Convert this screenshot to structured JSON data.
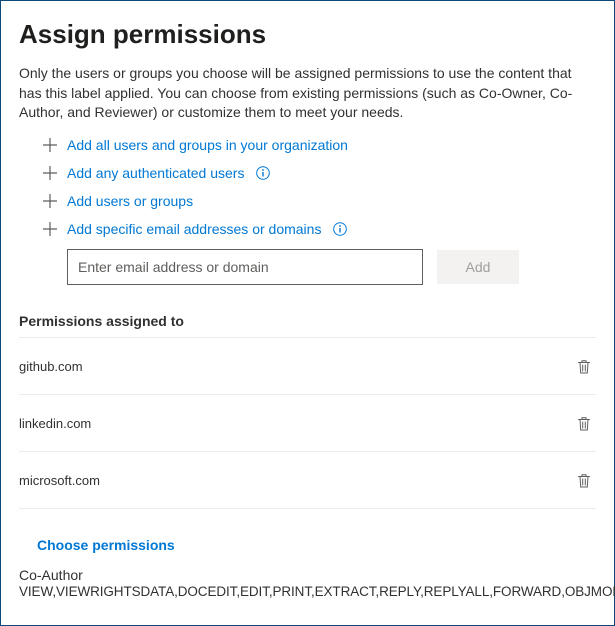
{
  "title": "Assign permissions",
  "intro": "Only the users or groups you choose will be assigned permissions to use the content that has this label applied. You can choose from existing permissions (such as Co-Owner, Co-Author, and Reviewer) or customize them to meet your needs.",
  "options": {
    "all_users": "Add all users and groups in your organization",
    "auth_users": "Add any authenticated users",
    "users_groups": "Add users or groups",
    "email_domains": "Add specific email addresses or domains"
  },
  "email_input": {
    "placeholder": "Enter email address or domain",
    "value": ""
  },
  "add_button": "Add",
  "permissions_label": "Permissions assigned to",
  "assigned": [
    {
      "name": "github.com"
    },
    {
      "name": "linkedin.com"
    },
    {
      "name": "microsoft.com"
    }
  ],
  "choose_permissions": "Choose permissions",
  "role": "Co-Author",
  "role_perms": "VIEW,VIEWRIGHTSDATA,DOCEDIT,EDIT,PRINT,EXTRACT,REPLY,REPLYALL,FORWARD,OBJMODEL"
}
